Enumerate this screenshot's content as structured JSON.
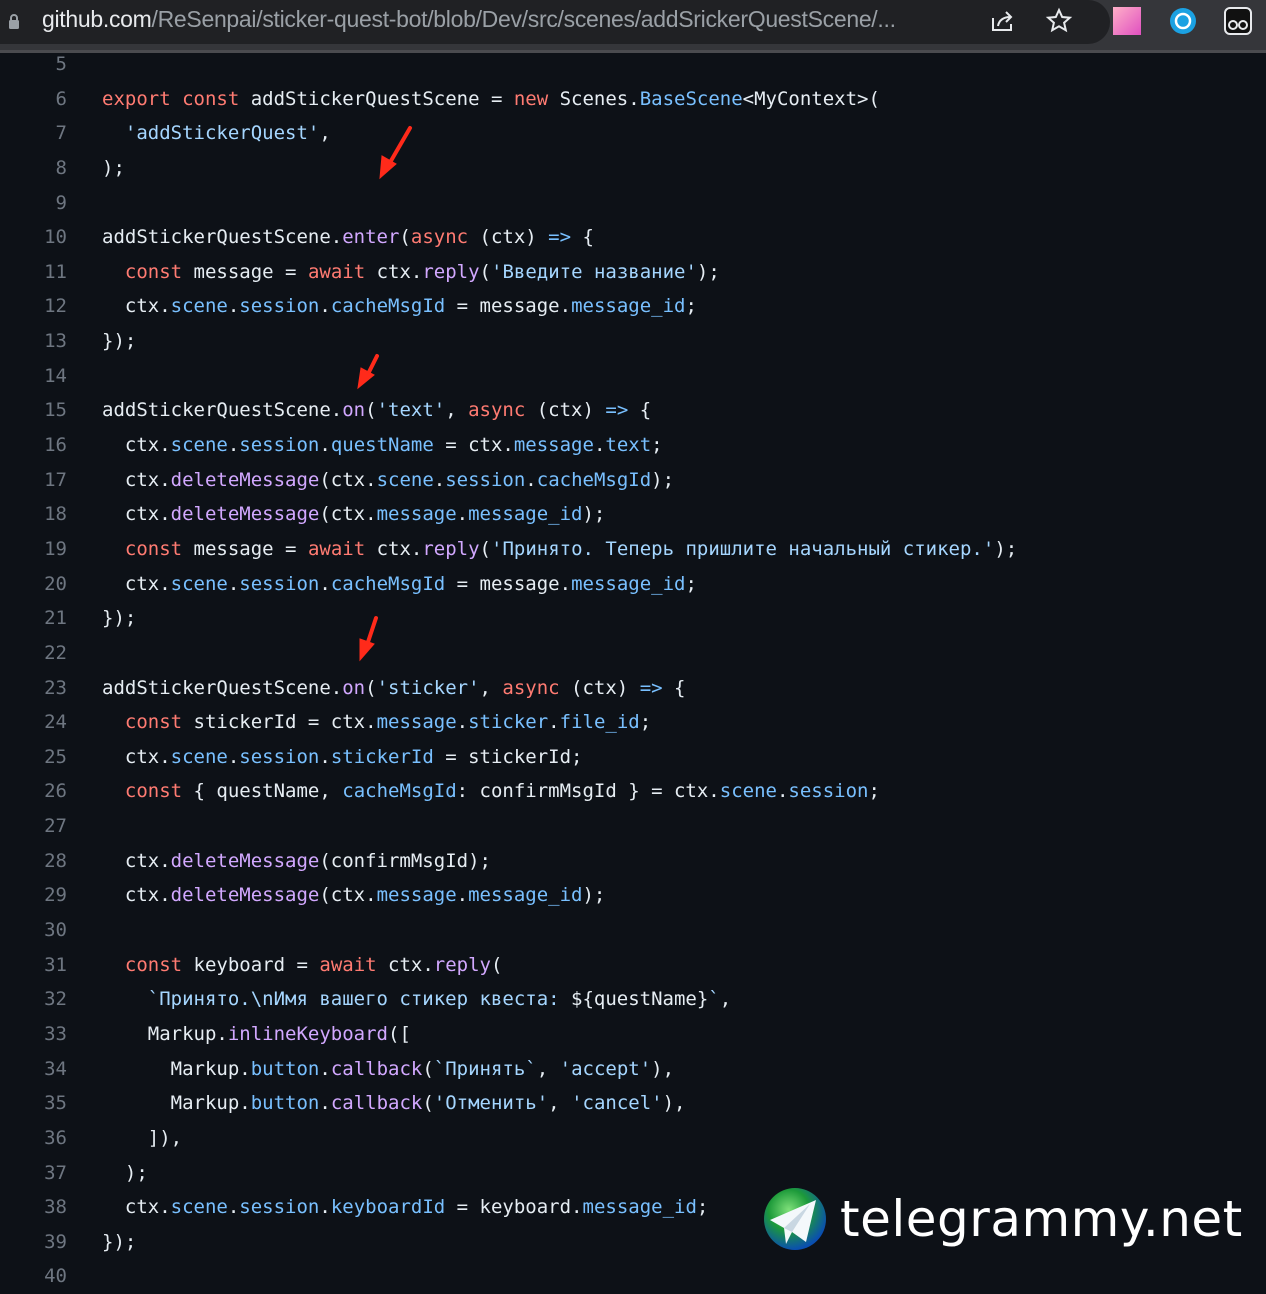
{
  "browser": {
    "url_host": "github.com",
    "url_path": "/ReSenpai/sticker-quest-bot/blob/Dev/src/scenes/addSrickerQuestScene/...",
    "icons": [
      "lock-icon",
      "share-icon",
      "star-icon",
      "extension-gradient-icon",
      "extension-sync-icon",
      "extension-mask-icon"
    ]
  },
  "colors": {
    "background": "#0d1117",
    "keyword": "#ff7b72",
    "function": "#d2a8ff",
    "property": "#79c0ff",
    "string": "#a5d6ff",
    "text": "#e6edf3",
    "line_number": "#6e7681",
    "arrow": "#ff2a1a"
  },
  "code": {
    "lines": [
      {
        "n": "5",
        "tokens": []
      },
      {
        "n": "6",
        "tokens": [
          [
            "k",
            "export"
          ],
          [
            "t",
            " "
          ],
          [
            "k",
            "const"
          ],
          [
            "t",
            " addStickerQuestScene = "
          ],
          [
            "k",
            "new"
          ],
          [
            "t",
            " Scenes."
          ],
          [
            "p",
            "BaseScene"
          ],
          [
            "t",
            "<MyContext>("
          ]
        ]
      },
      {
        "n": "7",
        "tokens": [
          [
            "t",
            "  "
          ],
          [
            "s",
            "'addStickerQuest'"
          ],
          [
            "t",
            ","
          ]
        ]
      },
      {
        "n": "8",
        "tokens": [
          [
            "t",
            ");"
          ]
        ]
      },
      {
        "n": "9",
        "tokens": []
      },
      {
        "n": "10",
        "tokens": [
          [
            "t",
            "addStickerQuestScene."
          ],
          [
            "f",
            "enter"
          ],
          [
            "t",
            "("
          ],
          [
            "k",
            "async"
          ],
          [
            "t",
            " (ctx) "
          ],
          [
            "p",
            "=>"
          ],
          [
            "t",
            " {"
          ]
        ]
      },
      {
        "n": "11",
        "tokens": [
          [
            "t",
            "  "
          ],
          [
            "k",
            "const"
          ],
          [
            "t",
            " message = "
          ],
          [
            "k",
            "await"
          ],
          [
            "t",
            " ctx."
          ],
          [
            "f",
            "reply"
          ],
          [
            "t",
            "("
          ],
          [
            "s",
            "'Введите название'"
          ],
          [
            "t",
            ");"
          ]
        ]
      },
      {
        "n": "12",
        "tokens": [
          [
            "t",
            "  ctx."
          ],
          [
            "p",
            "scene"
          ],
          [
            "t",
            "."
          ],
          [
            "p",
            "session"
          ],
          [
            "t",
            "."
          ],
          [
            "p",
            "cacheMsgId"
          ],
          [
            "t",
            " = message."
          ],
          [
            "p",
            "message_id"
          ],
          [
            "t",
            ";"
          ]
        ]
      },
      {
        "n": "13",
        "tokens": [
          [
            "t",
            "});"
          ]
        ]
      },
      {
        "n": "14",
        "tokens": []
      },
      {
        "n": "15",
        "tokens": [
          [
            "t",
            "addStickerQuestScene."
          ],
          [
            "f",
            "on"
          ],
          [
            "t",
            "("
          ],
          [
            "s",
            "'text'"
          ],
          [
            "t",
            ", "
          ],
          [
            "k",
            "async"
          ],
          [
            "t",
            " (ctx) "
          ],
          [
            "p",
            "=>"
          ],
          [
            "t",
            " {"
          ]
        ]
      },
      {
        "n": "16",
        "tokens": [
          [
            "t",
            "  ctx."
          ],
          [
            "p",
            "scene"
          ],
          [
            "t",
            "."
          ],
          [
            "p",
            "session"
          ],
          [
            "t",
            "."
          ],
          [
            "p",
            "questName"
          ],
          [
            "t",
            " = ctx."
          ],
          [
            "p",
            "message"
          ],
          [
            "t",
            "."
          ],
          [
            "p",
            "text"
          ],
          [
            "t",
            ";"
          ]
        ]
      },
      {
        "n": "17",
        "tokens": [
          [
            "t",
            "  ctx."
          ],
          [
            "f",
            "deleteMessage"
          ],
          [
            "t",
            "(ctx."
          ],
          [
            "p",
            "scene"
          ],
          [
            "t",
            "."
          ],
          [
            "p",
            "session"
          ],
          [
            "t",
            "."
          ],
          [
            "p",
            "cacheMsgId"
          ],
          [
            "t",
            ");"
          ]
        ]
      },
      {
        "n": "18",
        "tokens": [
          [
            "t",
            "  ctx."
          ],
          [
            "f",
            "deleteMessage"
          ],
          [
            "t",
            "(ctx."
          ],
          [
            "p",
            "message"
          ],
          [
            "t",
            "."
          ],
          [
            "p",
            "message_id"
          ],
          [
            "t",
            ");"
          ]
        ]
      },
      {
        "n": "19",
        "tokens": [
          [
            "t",
            "  "
          ],
          [
            "k",
            "const"
          ],
          [
            "t",
            " message = "
          ],
          [
            "k",
            "await"
          ],
          [
            "t",
            " ctx."
          ],
          [
            "f",
            "reply"
          ],
          [
            "t",
            "("
          ],
          [
            "s",
            "'Принято. Теперь пришлите начальный стикер.'"
          ],
          [
            "t",
            ");"
          ]
        ]
      },
      {
        "n": "20",
        "tokens": [
          [
            "t",
            "  ctx."
          ],
          [
            "p",
            "scene"
          ],
          [
            "t",
            "."
          ],
          [
            "p",
            "session"
          ],
          [
            "t",
            "."
          ],
          [
            "p",
            "cacheMsgId"
          ],
          [
            "t",
            " = message."
          ],
          [
            "p",
            "message_id"
          ],
          [
            "t",
            ";"
          ]
        ]
      },
      {
        "n": "21",
        "tokens": [
          [
            "t",
            "});"
          ]
        ]
      },
      {
        "n": "22",
        "tokens": []
      },
      {
        "n": "23",
        "tokens": [
          [
            "t",
            "addStickerQuestScene."
          ],
          [
            "f",
            "on"
          ],
          [
            "t",
            "("
          ],
          [
            "s",
            "'sticker'"
          ],
          [
            "t",
            ", "
          ],
          [
            "k",
            "async"
          ],
          [
            "t",
            " (ctx) "
          ],
          [
            "p",
            "=>"
          ],
          [
            "t",
            " {"
          ]
        ]
      },
      {
        "n": "24",
        "tokens": [
          [
            "t",
            "  "
          ],
          [
            "k",
            "const"
          ],
          [
            "t",
            " stickerId = ctx."
          ],
          [
            "p",
            "message"
          ],
          [
            "t",
            "."
          ],
          [
            "p",
            "sticker"
          ],
          [
            "t",
            "."
          ],
          [
            "p",
            "file_id"
          ],
          [
            "t",
            ";"
          ]
        ]
      },
      {
        "n": "25",
        "tokens": [
          [
            "t",
            "  ctx."
          ],
          [
            "p",
            "scene"
          ],
          [
            "t",
            "."
          ],
          [
            "p",
            "session"
          ],
          [
            "t",
            "."
          ],
          [
            "p",
            "stickerId"
          ],
          [
            "t",
            " = stickerId;"
          ]
        ]
      },
      {
        "n": "26",
        "tokens": [
          [
            "t",
            "  "
          ],
          [
            "k",
            "const"
          ],
          [
            "t",
            " { questName, "
          ],
          [
            "p",
            "cacheMsgId"
          ],
          [
            "t",
            ": confirmMsgId } = ctx."
          ],
          [
            "p",
            "scene"
          ],
          [
            "t",
            "."
          ],
          [
            "p",
            "session"
          ],
          [
            "t",
            ";"
          ]
        ]
      },
      {
        "n": "27",
        "tokens": []
      },
      {
        "n": "28",
        "tokens": [
          [
            "t",
            "  ctx."
          ],
          [
            "f",
            "deleteMessage"
          ],
          [
            "t",
            "(confirmMsgId);"
          ]
        ]
      },
      {
        "n": "29",
        "tokens": [
          [
            "t",
            "  ctx."
          ],
          [
            "f",
            "deleteMessage"
          ],
          [
            "t",
            "(ctx."
          ],
          [
            "p",
            "message"
          ],
          [
            "t",
            "."
          ],
          [
            "p",
            "message_id"
          ],
          [
            "t",
            ");"
          ]
        ]
      },
      {
        "n": "30",
        "tokens": []
      },
      {
        "n": "31",
        "tokens": [
          [
            "t",
            "  "
          ],
          [
            "k",
            "const"
          ],
          [
            "t",
            " keyboard = "
          ],
          [
            "k",
            "await"
          ],
          [
            "t",
            " ctx."
          ],
          [
            "f",
            "reply"
          ],
          [
            "t",
            "("
          ]
        ]
      },
      {
        "n": "32",
        "tokens": [
          [
            "t",
            "    "
          ],
          [
            "s",
            "`Принято.\\nИмя вашего стикер квеста: "
          ],
          [
            "t",
            "${questName}"
          ],
          [
            "s",
            "`"
          ],
          [
            "t",
            ","
          ]
        ]
      },
      {
        "n": "33",
        "tokens": [
          [
            "t",
            "    Markup."
          ],
          [
            "f",
            "inlineKeyboard"
          ],
          [
            "t",
            "(["
          ]
        ]
      },
      {
        "n": "34",
        "tokens": [
          [
            "t",
            "      Markup."
          ],
          [
            "p",
            "button"
          ],
          [
            "t",
            "."
          ],
          [
            "f",
            "callback"
          ],
          [
            "t",
            "("
          ],
          [
            "s",
            "`Принять`"
          ],
          [
            "t",
            ", "
          ],
          [
            "s",
            "'accept'"
          ],
          [
            "t",
            "),"
          ]
        ]
      },
      {
        "n": "35",
        "tokens": [
          [
            "t",
            "      Markup."
          ],
          [
            "p",
            "button"
          ],
          [
            "t",
            "."
          ],
          [
            "f",
            "callback"
          ],
          [
            "t",
            "("
          ],
          [
            "s",
            "'Отменить'"
          ],
          [
            "t",
            ", "
          ],
          [
            "s",
            "'cancel'"
          ],
          [
            "t",
            "),"
          ]
        ]
      },
      {
        "n": "36",
        "tokens": [
          [
            "t",
            "    ]),"
          ]
        ]
      },
      {
        "n": "37",
        "tokens": [
          [
            "t",
            "  );"
          ]
        ]
      },
      {
        "n": "38",
        "tokens": [
          [
            "t",
            "  ctx."
          ],
          [
            "p",
            "scene"
          ],
          [
            "t",
            "."
          ],
          [
            "p",
            "session"
          ],
          [
            "t",
            "."
          ],
          [
            "p",
            "keyboardId"
          ],
          [
            "t",
            " = keyboard."
          ],
          [
            "p",
            "message_id"
          ],
          [
            "t",
            ";"
          ]
        ]
      },
      {
        "n": "39",
        "tokens": [
          [
            "t",
            "});"
          ]
        ]
      },
      {
        "n": "40",
        "tokens": []
      }
    ]
  },
  "watermark": {
    "text": "telegrammy.net",
    "icon": "telegram-globe-logo-icon"
  }
}
